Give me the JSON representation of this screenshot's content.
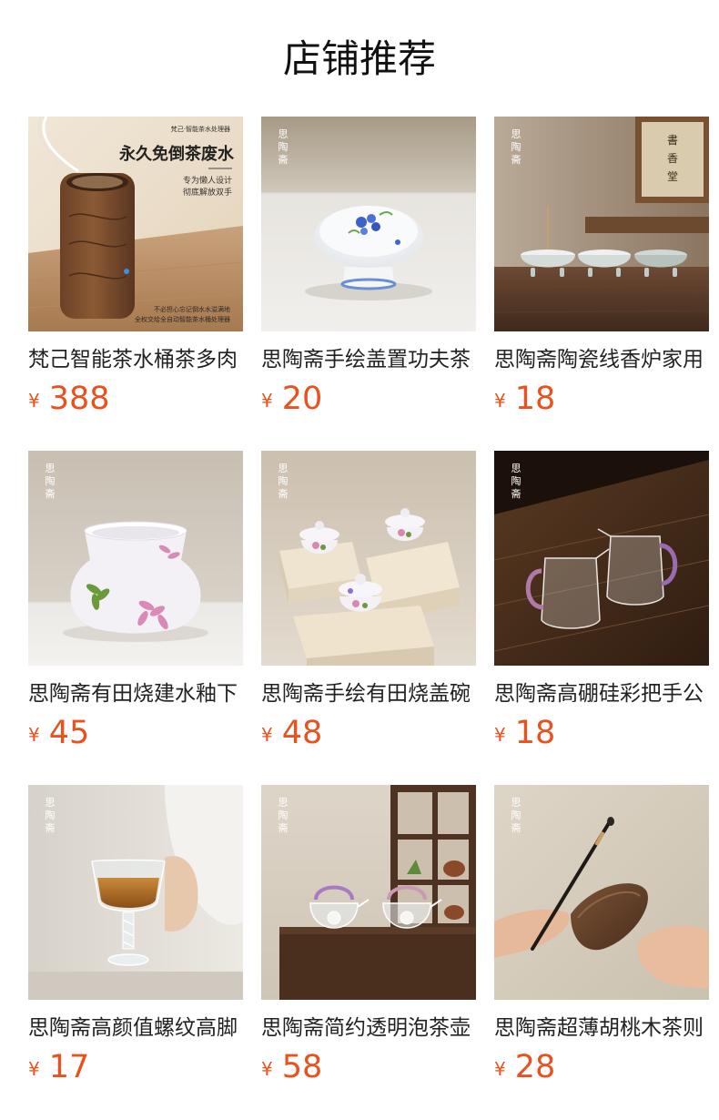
{
  "section": {
    "title": "店铺推荐"
  },
  "theme": {
    "price_color": "#e8521e"
  },
  "products": [
    {
      "name": "梵己智能茶水桶茶多肉",
      "currency": "¥",
      "price": "388",
      "image_text": {
        "brand_line": "梵己·智能茶水处理器",
        "headline": "永久免倒茶废水",
        "sub1": "专为懒人设计",
        "sub2": "彻底解放双手",
        "foot1": "不必担心忘记倒水水溢满地",
        "foot2": "全权交给全自动智能茶水桶处理器"
      }
    },
    {
      "name": "思陶斋手绘盖置功夫茶",
      "currency": "¥",
      "price": "20",
      "image_text": {
        "brand": "思陶斋"
      }
    },
    {
      "name": "思陶斋陶瓷线香炉家用",
      "currency": "¥",
      "price": "18",
      "image_text": {
        "brand": "思陶斋"
      }
    },
    {
      "name": "思陶斋有田烧建水釉下",
      "currency": "¥",
      "price": "45",
      "image_text": {
        "brand": "思陶斋"
      }
    },
    {
      "name": "思陶斋手绘有田烧盖碗",
      "currency": "¥",
      "price": "48",
      "image_text": {
        "brand": "思陶斋"
      }
    },
    {
      "name": "思陶斋高硼硅彩把手公",
      "currency": "¥",
      "price": "18",
      "image_text": {
        "brand": "思陶斋"
      }
    },
    {
      "name": "思陶斋高颜值螺纹高脚",
      "currency": "¥",
      "price": "17",
      "image_text": {
        "brand": "思陶斋"
      }
    },
    {
      "name": "思陶斋简约透明泡茶壶",
      "currency": "¥",
      "price": "58",
      "image_text": {
        "brand": "思陶斋"
      }
    },
    {
      "name": "思陶斋超薄胡桃木茶则",
      "currency": "¥",
      "price": "28",
      "image_text": {
        "brand": "思陶斋"
      }
    }
  ]
}
